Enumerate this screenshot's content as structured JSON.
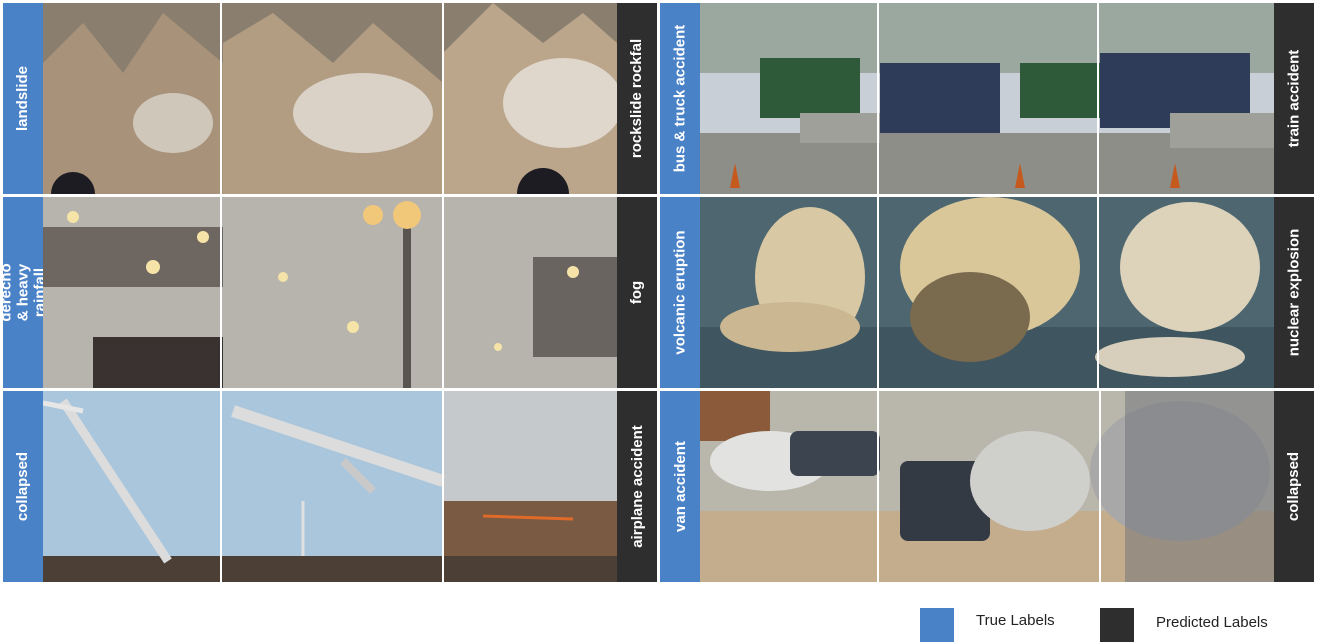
{
  "colors": {
    "true_label": "#4a82c8",
    "predicted_label": "#2e2e2e"
  },
  "cells": [
    {
      "true_label": "landslide",
      "predicted_label": "rockslide rockfal",
      "scene": "rocky mountain slope with dust cloud"
    },
    {
      "true_label": "bus & truck accident",
      "predicted_label": "train accident",
      "scene": "street with bus and truck"
    },
    {
      "true_label": "derecho & heavy rainfall",
      "predicted_label": "fog",
      "scene": "foggy street with lamps"
    },
    {
      "true_label": "volcanic eruption",
      "predicted_label": "nuclear explosion",
      "scene": "eruption plume over water"
    },
    {
      "true_label": "collapsed",
      "predicted_label": "airplane accident",
      "scene": "falling wind turbine"
    },
    {
      "true_label": "van accident",
      "predicted_label": "collapsed",
      "scene": "car crash with smoke"
    }
  ],
  "legend": {
    "true_label": "True Labels",
    "predicted_label": "Predicted Labels"
  }
}
